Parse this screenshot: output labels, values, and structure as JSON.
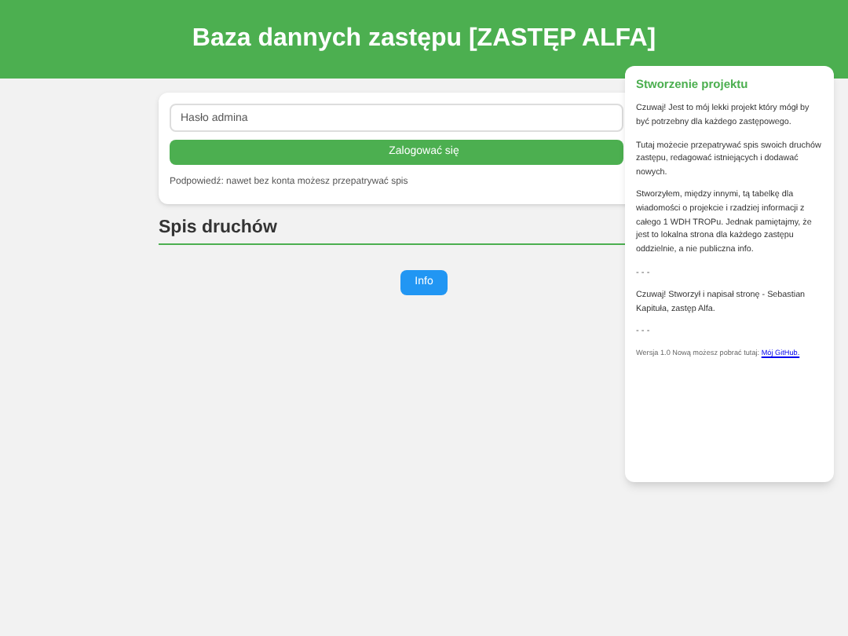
{
  "header": {
    "title": "Baza dannych zastępu [ZASTĘP ALFA]"
  },
  "login": {
    "password_placeholder": "Hasło admina",
    "button": "Zalogować się",
    "hint": "Podpowiedź: nawet bez konta możesz przepatrywać spis"
  },
  "list": {
    "heading": "Spis druchów",
    "info_button": "Info"
  },
  "panel": {
    "title": "Stworzenie projektu",
    "paragraphs": [
      {
        "kind": "text",
        "text": "Czuwaj! Jest to mój lekki projekt który mógł by być potrzebny dla każdego zastępowego."
      },
      {
        "kind": "text",
        "text": "Tutaj możecie przepatrywać spis swoich druchów zastępu, redagować istniejących i dodawać nowych."
      },
      {
        "kind": "text",
        "text": "Stworzyłem, między innymi, tą tabelkę dla wiadomości o projekcie i rzadziej informacji z całego 1 WDH TROPu. Jednak pamiętajmy, że jest to lokalna strona dla każdego zastępu oddzielnie, a nie publiczna info."
      },
      {
        "kind": "separator",
        "text": "- - -"
      },
      {
        "kind": "text",
        "text": "Czuwaj! Stworzył i napisał stronę - Sebastian Kapituła, zastęp Alfa."
      },
      {
        "kind": "separator",
        "text": "- - -"
      },
      {
        "kind": "version",
        "text": "Wersja 1.0 Nową możesz pobrać tutaj:",
        "link": "Mój GitHub."
      }
    ]
  }
}
